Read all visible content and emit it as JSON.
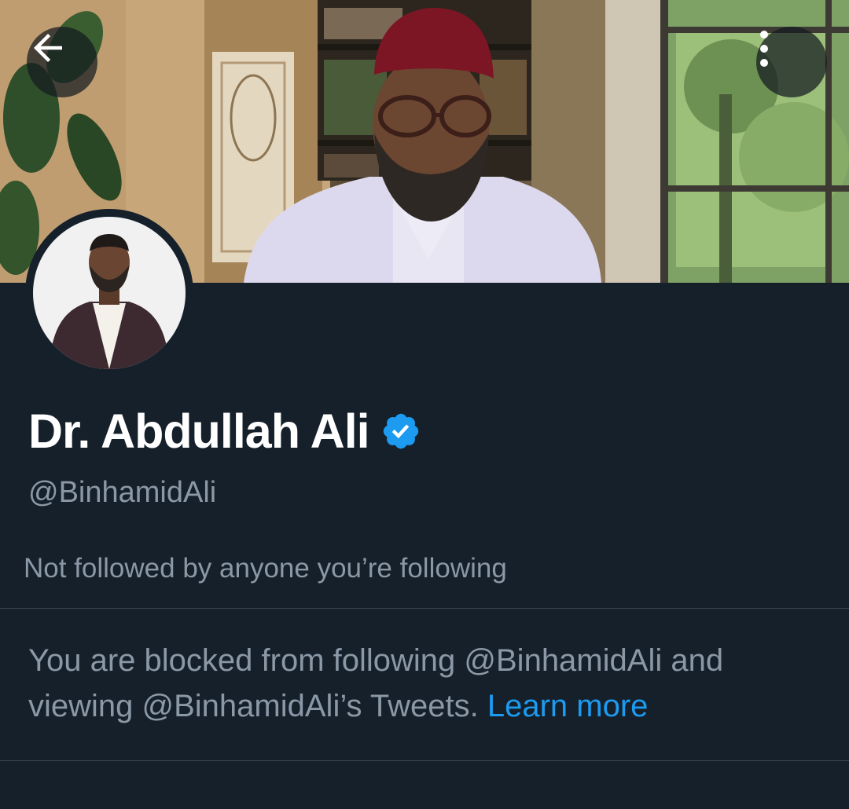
{
  "profile": {
    "display_name": "Dr. Abdullah Ali",
    "handle": "@BinhamidAli",
    "verified": true,
    "followed_by_text": "Not followed by anyone you’re following"
  },
  "blocked_notice": {
    "line_1": "You are blocked from following @BinhamidAli and",
    "line_2": "viewing @BinhamidAli’s Tweets.",
    "learn_more_label": "Learn more"
  },
  "icons": {
    "back": "arrow-left-icon",
    "more": "vertical-dots-icon",
    "verified": "verified-badge-icon"
  },
  "colors": {
    "background": "#15202b",
    "accent": "#1d9bf0",
    "secondary_text": "#8b98a5",
    "divider": "#38444d"
  }
}
